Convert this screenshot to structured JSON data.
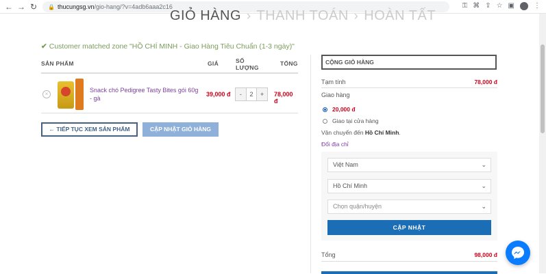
{
  "browser": {
    "url_host": "thucungsg.vn",
    "url_path": "/gio-hang/?v=4adb6aaa2c16",
    "back": "←",
    "forward": "→",
    "reload": "↻"
  },
  "steps": {
    "cart": "GIỎ HÀNG",
    "checkout": "THANH TOÁN",
    "done": "HOÀN TẤT",
    "separator": "›"
  },
  "notice": {
    "check": "✔",
    "text": "Customer matched zone \"HỒ CHÍ MINH - Giao Hàng Tiêu Chuẩn (1-3 ngày)\""
  },
  "cart_table": {
    "headers": {
      "product": "SẢN PHẨM",
      "price": "GIÁ",
      "qty_line1": "SỐ",
      "qty_line2": "LƯỢNG",
      "total": "TỔNG"
    },
    "items": [
      {
        "remove": "×",
        "name": "Snack chó Pedigree Tasty Bites gói 60g - gà",
        "price": "39,000 đ",
        "qty_minus": "-",
        "qty": "2",
        "qty_plus": "+",
        "total": "78,000 đ"
      }
    ]
  },
  "actions": {
    "continue_label": "← TIẾP TỤC XEM SẢN PHẨM",
    "update_label": "CẬP NHẬT GIỎ HÀNG"
  },
  "totals": {
    "title": "CỘNG GIỎ HÀNG",
    "subtotal_label": "Tạm tính",
    "subtotal_value": "78,000 đ",
    "shipping_label": "Giao hàng",
    "shipping_options": [
      {
        "label": "20,000 đ",
        "selected": true
      },
      {
        "label": "Giao tại cửa hàng",
        "selected": false
      }
    ],
    "ship_to_prefix": "Vận chuyển đến",
    "ship_to_city": "Hồ Chí Minh",
    "ship_to_suffix": ".",
    "change_address": "Đổi địa chỉ",
    "country": "Việt Nam",
    "province": "Hồ Chí Minh",
    "district_placeholder": "Chọn quận/huyện",
    "recalc_label": "CẬP NHẬT",
    "total_label": "Tổng",
    "total_value": "98,000 đ"
  },
  "colors": {
    "accent_blue": "#1b6db5",
    "price_red": "#d0021b",
    "link_purple": "#7b3fa0",
    "notice_green": "#7a9c59"
  },
  "icons": {
    "messenger": "messenger-icon"
  }
}
